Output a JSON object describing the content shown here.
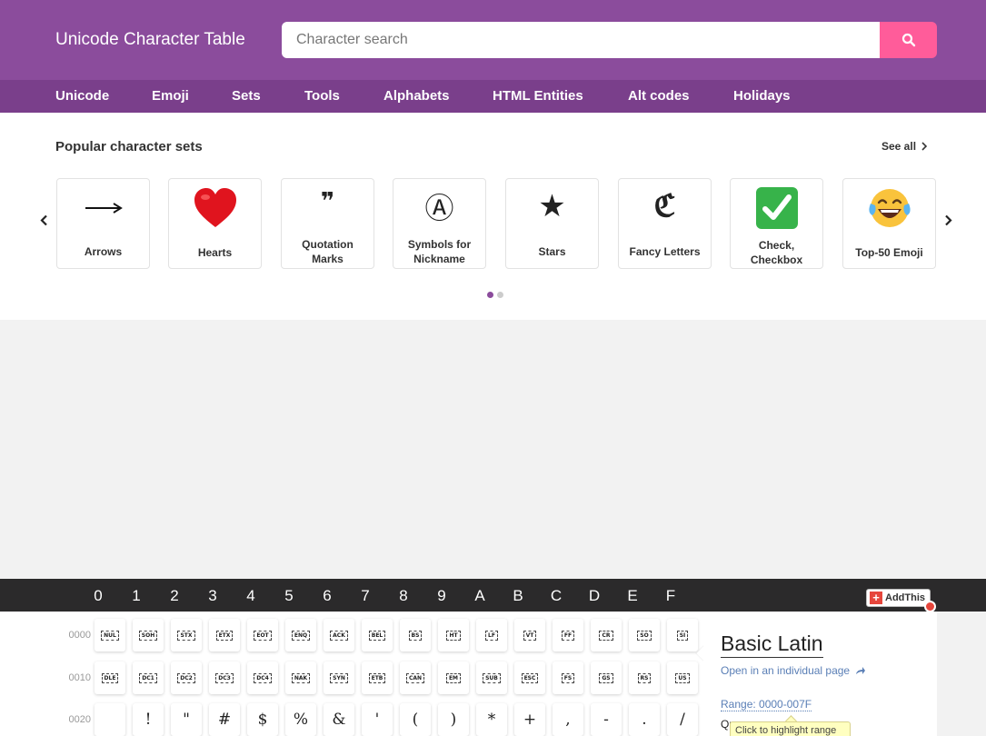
{
  "header": {
    "brand": "Unicode Character Table",
    "search_placeholder": "Character search",
    "search_icon": "search-icon",
    "accent_color": "#8b4c9c",
    "search_button_color": "#ff5c9a"
  },
  "nav": {
    "items": [
      {
        "label": "Unicode"
      },
      {
        "label": "Emoji"
      },
      {
        "label": "Sets"
      },
      {
        "label": "Tools"
      },
      {
        "label": "Alphabets"
      },
      {
        "label": "HTML Entities"
      },
      {
        "label": "Alt codes"
      },
      {
        "label": "Holidays"
      }
    ]
  },
  "popular": {
    "title": "Popular character sets",
    "see_all": "See all",
    "sets": [
      {
        "label": "Arrows",
        "glyph": "⟶"
      },
      {
        "label": "Hearts",
        "glyph": "❤"
      },
      {
        "label": "Quotation Marks",
        "glyph": "❞"
      },
      {
        "label": "Symbols for Nickname",
        "glyph": "Ⓐ"
      },
      {
        "label": "Stars",
        "glyph": "★"
      },
      {
        "label": "Fancy Letters",
        "glyph": "ℭ"
      },
      {
        "label": "Check, Checkbox",
        "glyph": "✓"
      },
      {
        "label": "Top-50 Emoji",
        "glyph": "😂"
      }
    ],
    "pager": {
      "pages": 2,
      "current": 1
    }
  },
  "table": {
    "columns": [
      "0",
      "1",
      "2",
      "3",
      "4",
      "5",
      "6",
      "7",
      "8",
      "9",
      "A",
      "B",
      "C",
      "D",
      "E",
      "F"
    ],
    "rows": [
      {
        "label": "0000",
        "cells": [
          "NUL",
          "SOH",
          "STX",
          "ETX",
          "EOT",
          "ENQ",
          "ACK",
          "BEL",
          "BS",
          "HT",
          "LF",
          "VT",
          "FF",
          "CR",
          "SO",
          "SI"
        ],
        "control": true
      },
      {
        "label": "0010",
        "cells": [
          "DLE",
          "DC1",
          "DC2",
          "DC3",
          "DC4",
          "NAK",
          "SYN",
          "ETB",
          "CAN",
          "EM",
          "SUB",
          "ESC",
          "FS",
          "GS",
          "RS",
          "US"
        ],
        "control": true
      },
      {
        "label": "0020",
        "cells": [
          " ",
          "!",
          "\"",
          "#",
          "$",
          "%",
          "&",
          "'",
          "(",
          ")",
          "*",
          "+",
          ",",
          "-",
          ".",
          "/"
        ],
        "control": false
      }
    ],
    "addthis_label": "AddThis"
  },
  "panel": {
    "title": "Basic Latin",
    "open_link": "Open in an individual page",
    "range": "Range: 0000-007F",
    "q_text": "Qu",
    "tooltip": "Click to highlight range"
  }
}
